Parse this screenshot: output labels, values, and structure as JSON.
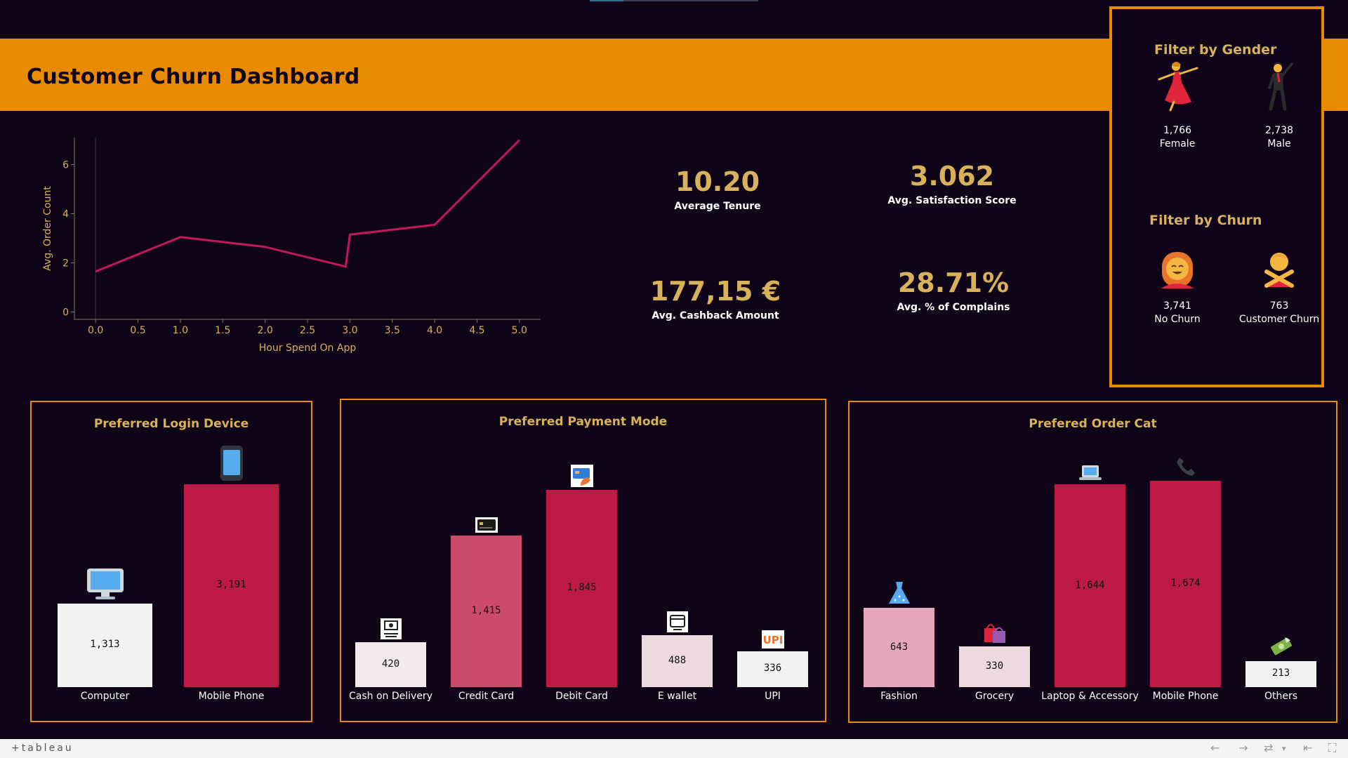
{
  "title": "Customer Churn Dashboard",
  "colors": {
    "accent": "#e88b00",
    "background": "#0f0418",
    "gold": "#d8b25a",
    "line": "#c2185b"
  },
  "kpis": {
    "tenure": {
      "value": "10.20",
      "label": "Average Tenure"
    },
    "satisfaction": {
      "value": "3.062",
      "label": "Avg. Satisfaction Score"
    },
    "cashback": {
      "value": "177,15 €",
      "label": "Avg. Cashback Amount"
    },
    "complains": {
      "value": "28.71%",
      "label": "Avg. % of Complains"
    }
  },
  "filters": {
    "gender_title": "Filter by Gender",
    "churn_title": "Filter by Churn",
    "female": {
      "count": "1,766",
      "label": "Female",
      "icon": "dancer-woman-icon"
    },
    "male": {
      "count": "2,738",
      "label": "Male",
      "icon": "dancer-man-icon"
    },
    "no_churn": {
      "count": "3,741",
      "label": "No Churn",
      "icon": "happy-person-icon"
    },
    "churn": {
      "count": "763",
      "label": "Customer Churn",
      "icon": "no-gesture-person-icon"
    }
  },
  "chart_data": [
    {
      "type": "line",
      "title": "",
      "xlabel": "Hour Spend On App",
      "ylabel": "Avg. Order Count",
      "x": [
        0.0,
        1.0,
        2.0,
        2.95,
        3.0,
        4.0,
        5.0
      ],
      "y": [
        1.65,
        3.05,
        2.65,
        1.85,
        3.15,
        3.55,
        7.0
      ],
      "xlim": [
        -0.25,
        5.25
      ],
      "ylim": [
        -0.3,
        7.1
      ],
      "xticks": [
        "0.0",
        "0.5",
        "1.0",
        "1.5",
        "2.0",
        "2.5",
        "3.0",
        "3.5",
        "4.0",
        "4.5",
        "5.0"
      ],
      "yticks": [
        "0",
        "2",
        "4",
        "6"
      ],
      "grid": false
    },
    {
      "type": "bar",
      "title": "Preferred Login Device",
      "categories": [
        "Computer",
        "Mobile Phone"
      ],
      "values": [
        1313,
        3191
      ],
      "value_labels": [
        "1,313",
        "3,191"
      ],
      "icons": [
        "computer-icon",
        "mobile-phone-icon"
      ],
      "colors": [
        "#f2f2f2",
        "#bd1a45"
      ]
    },
    {
      "type": "bar",
      "title": "Preferred Payment Mode",
      "categories": [
        "Cash on Delivery",
        "Credit Card",
        "Debit Card",
        "E wallet",
        "UPI"
      ],
      "values": [
        420,
        1415,
        1845,
        488,
        336
      ],
      "value_labels": [
        "420",
        "1,415",
        "1,845",
        "488",
        "336"
      ],
      "icons": [
        "cash-icon",
        "credit-card-icon",
        "debit-card-icon",
        "e-wallet-icon",
        "upi-icon"
      ],
      "colors": [
        "#f3eaee",
        "#cc4b6c",
        "#bd1a45",
        "#efd9e0",
        "#f2f2f2"
      ]
    },
    {
      "type": "bar",
      "title": "Prefered Order Cat",
      "categories": [
        "Fashion",
        "Grocery",
        "Laptop & Accessory",
        "Mobile Phone",
        "Others"
      ],
      "values": [
        643,
        330,
        1644,
        1674,
        213
      ],
      "value_labels": [
        "643",
        "330",
        "1,644",
        "1,674",
        "213"
      ],
      "icons": [
        "dress-icon",
        "shopping-bags-icon",
        "laptop-icon",
        "telephone-icon",
        "money-icon"
      ],
      "colors": [
        "#e5a7bd",
        "#efd9e0",
        "#bd1a45",
        "#bd1a45",
        "#f2f2f2"
      ]
    }
  ],
  "footer": {
    "brand": "+tableau"
  }
}
